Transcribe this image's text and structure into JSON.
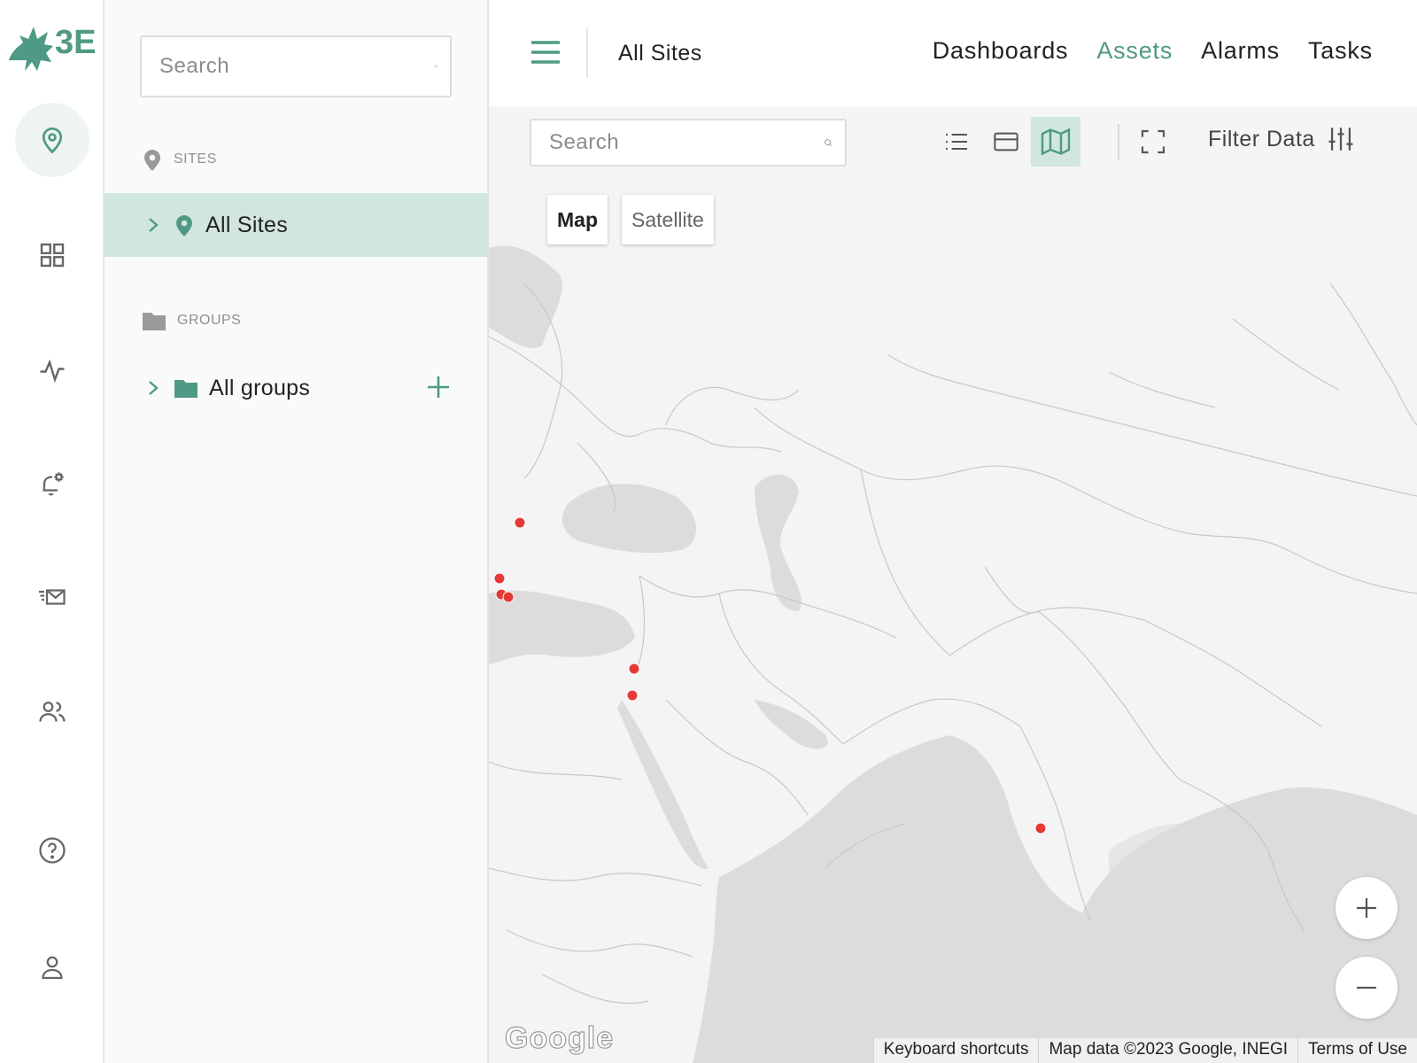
{
  "brand": {
    "logo_text": "3E",
    "color": "#4f9a84"
  },
  "colors": {
    "accent": "#4f9a84",
    "selected_bg": "#d2e6e0",
    "marker": "#e53935"
  },
  "rail": {
    "items": [
      {
        "icon": "map-pin-icon",
        "active": true
      },
      {
        "icon": "dashboard-grid-icon"
      },
      {
        "icon": "activity-pulse-icon"
      },
      {
        "icon": "alarm-settings-icon"
      },
      {
        "icon": "send-mail-icon"
      },
      {
        "icon": "users-icon"
      },
      {
        "icon": "help-icon"
      },
      {
        "icon": "user-profile-icon"
      }
    ]
  },
  "sidebar": {
    "search_placeholder": "Search",
    "sites": {
      "heading": "SITES",
      "items": [
        {
          "label": "All Sites",
          "selected": true
        }
      ]
    },
    "groups": {
      "heading": "GROUPS",
      "items": [
        {
          "label": "All groups"
        }
      ]
    }
  },
  "header": {
    "breadcrumb": "All Sites",
    "nav": [
      {
        "label": "Dashboards",
        "active": false
      },
      {
        "label": "Assets",
        "active": true
      },
      {
        "label": "Alarms",
        "active": false
      },
      {
        "label": "Tasks",
        "active": false
      }
    ]
  },
  "toolbar": {
    "search_placeholder": "Search",
    "views": [
      "list-view-icon",
      "card-view-icon",
      "map-view-icon"
    ],
    "active_view": "map-view-icon",
    "filter_label": "Filter Data"
  },
  "map": {
    "type_buttons": [
      {
        "label": "Map",
        "active": true
      },
      {
        "label": "Satellite",
        "active": false
      }
    ],
    "attribution": {
      "shortcuts": "Keyboard shortcuts",
      "data": "Map data ©2023 Google, INEGI",
      "terms": "Terms of Use"
    },
    "logo_text": "Google",
    "site_marker_count": 7
  }
}
